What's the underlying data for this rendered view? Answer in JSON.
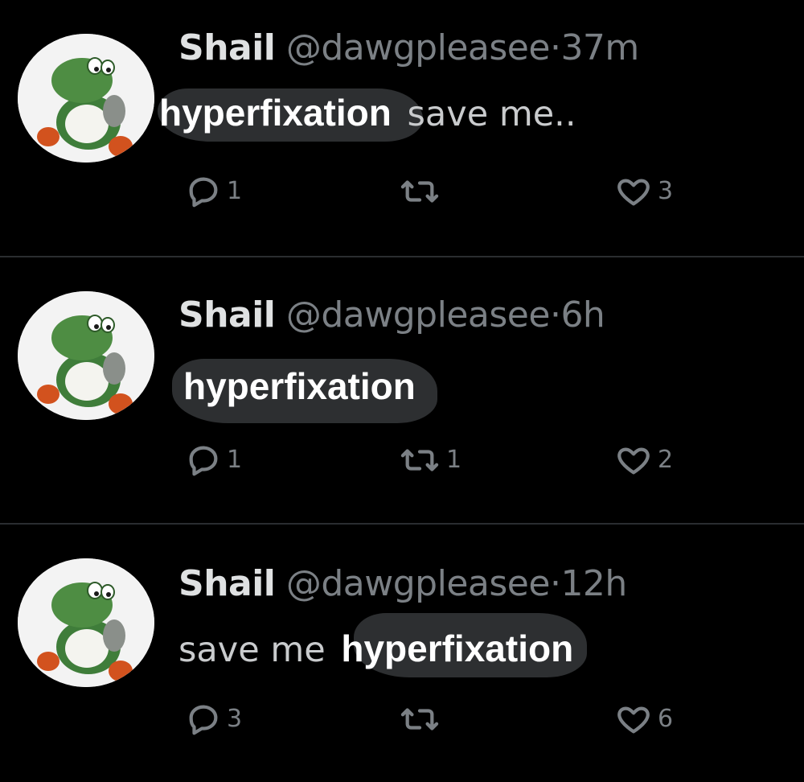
{
  "colors": {
    "background": "#000000",
    "name": "#dfe1e2",
    "muted": "#7b8085",
    "text": "#c9cbcd",
    "highlight_text": "#ffffff",
    "sticker_bg": "#2d2f31",
    "divider": "#2a2d30"
  },
  "tweets": [
    {
      "name": "Shail",
      "handle": "@dawgpleasee",
      "separator": "·",
      "time": "37m",
      "text_highlight": "hyperfixation",
      "text_plain": "save me..",
      "replies": "1",
      "reposts": "",
      "likes": "3"
    },
    {
      "name": "Shail",
      "handle": "@dawgpleasee",
      "separator": "·",
      "time": "6h",
      "text_highlight": "hyperfixation",
      "text_plain": "",
      "replies": "1",
      "reposts": "1",
      "likes": "2"
    },
    {
      "name": "Shail",
      "handle": "@dawgpleasee",
      "separator": "·",
      "time": "12h",
      "text_plain": "save me",
      "text_highlight": "hyperfixation",
      "replies": "3",
      "reposts": "",
      "likes": "6"
    }
  ]
}
